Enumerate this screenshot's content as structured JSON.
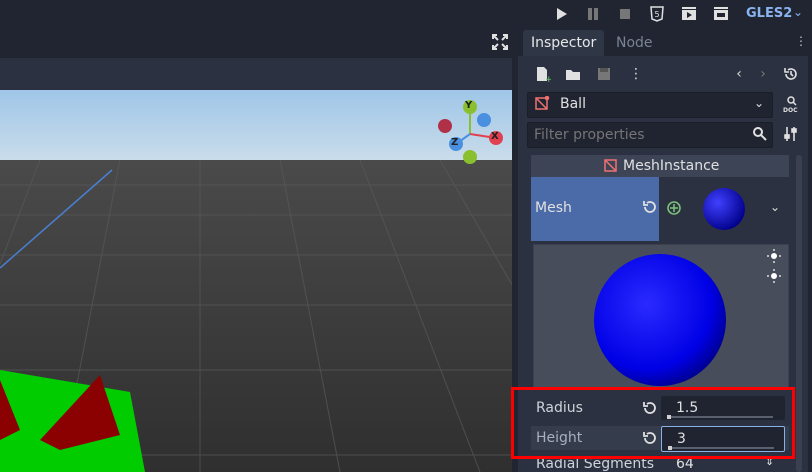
{
  "topbar": {
    "renderer": "GLES2",
    "icons": [
      "play-icon",
      "pause-icon",
      "stop-icon",
      "html5-icon",
      "play-scene-icon",
      "play-custom-scene-icon"
    ]
  },
  "viewport": {
    "gizmo": {
      "x_label": "X",
      "y_label": "Y",
      "z_label": "Z"
    }
  },
  "dock": {
    "tabs": [
      {
        "label": "Inspector",
        "active": true
      },
      {
        "label": "Node",
        "active": false
      }
    ]
  },
  "inspector": {
    "object_name": "Ball",
    "filter_placeholder": "Filter properties",
    "class_name": "MeshInstance",
    "mesh_label": "Mesh",
    "properties": [
      {
        "label": "Radius",
        "value": "1.5"
      },
      {
        "label": "Height",
        "value": "3"
      },
      {
        "label": "Radial Segments",
        "value": "64"
      }
    ]
  },
  "colors": {
    "accent": "#4a6aa8",
    "highlight": "#ff0000",
    "sphere": "#0000ff",
    "ground": "#00cc00",
    "cone": "#8b0000"
  }
}
